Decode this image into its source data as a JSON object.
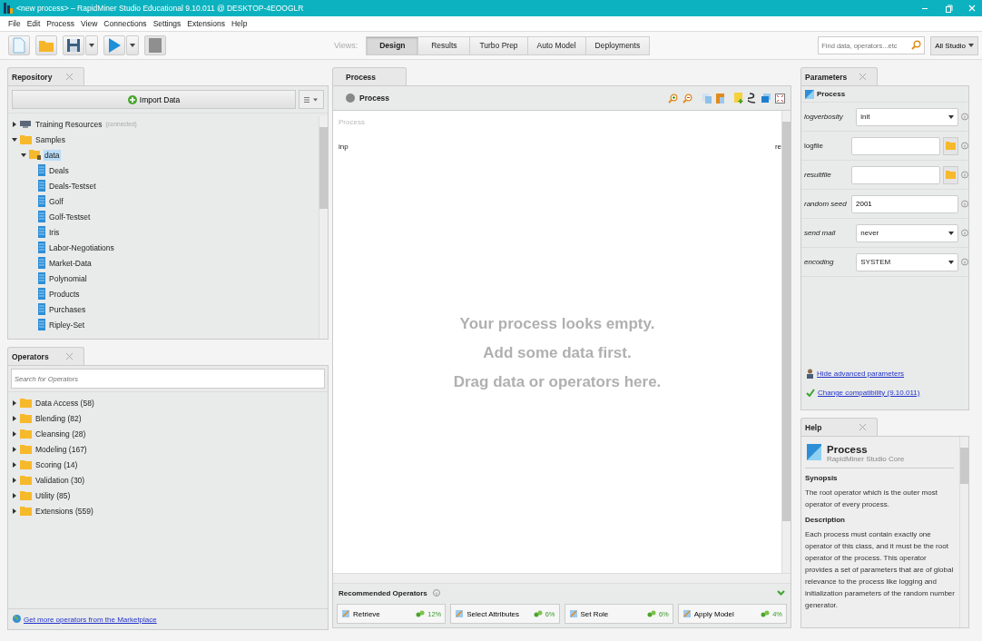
{
  "window": {
    "title": "<new process> – RapidMiner Studio Educational 9.10.011 @ DESKTOP-4EOOGLR"
  },
  "menu": [
    "File",
    "Edit",
    "Process",
    "View",
    "Connections",
    "Settings",
    "Extensions",
    "Help"
  ],
  "toolbar": {
    "views_label": "Views:",
    "views": [
      {
        "label": "Design",
        "selected": true
      },
      {
        "label": "Results",
        "selected": false
      },
      {
        "label": "Turbo Prep",
        "selected": false
      },
      {
        "label": "Auto Model",
        "selected": false
      },
      {
        "label": "Deployments",
        "selected": false
      }
    ],
    "search": {
      "placeholder": "Find data, operators...etc"
    },
    "scope": "All Studio"
  },
  "repository": {
    "tab": "Repository",
    "import_button": "Import Data",
    "tree": [
      {
        "label": "Training Resources",
        "note": "(connected)",
        "kind": "server",
        "expanded": false,
        "selected": false
      },
      {
        "label": "Samples",
        "kind": "folder",
        "expanded": true,
        "selected": false,
        "children": [
          {
            "label": "data",
            "kind": "locked-folder",
            "expanded": true,
            "selected": true,
            "children": [
              {
                "label": "Deals",
                "kind": "data",
                "selected": false
              },
              {
                "label": "Deals-Testset",
                "kind": "data",
                "selected": false
              },
              {
                "label": "Golf",
                "kind": "data",
                "selected": false
              },
              {
                "label": "Golf-Testset",
                "kind": "data",
                "selected": false
              },
              {
                "label": "Iris",
                "kind": "data",
                "selected": false
              },
              {
                "label": "Labor-Negotiations",
                "kind": "data",
                "selected": false
              },
              {
                "label": "Market-Data",
                "kind": "data",
                "selected": false
              },
              {
                "label": "Polynomial",
                "kind": "data",
                "selected": false
              },
              {
                "label": "Products",
                "kind": "data",
                "selected": false
              },
              {
                "label": "Purchases",
                "kind": "data",
                "selected": false
              },
              {
                "label": "Ripley-Set",
                "kind": "data",
                "selected": false
              }
            ]
          }
        ]
      }
    ]
  },
  "operators": {
    "tab": "Operators",
    "search": {
      "placeholder": "Search for Operators"
    },
    "groups": [
      {
        "label": "Data Access (58)",
        "expanded": false
      },
      {
        "label": "Blending (82)",
        "expanded": false
      },
      {
        "label": "Cleansing (28)",
        "expanded": false
      },
      {
        "label": "Modeling (167)",
        "expanded": false
      },
      {
        "label": "Scoring (14)",
        "expanded": false
      },
      {
        "label": "Validation (30)",
        "expanded": false
      },
      {
        "label": "Utility (85)",
        "expanded": false
      },
      {
        "label": "Extensions (559)",
        "expanded": false
      }
    ],
    "marketplace_link": "Get more operators from the Marketplace"
  },
  "process": {
    "tab": "Process",
    "breadcrumb": "Process",
    "canvas_title": "Process",
    "input_port": "inp",
    "output_port": "re",
    "empty_message": [
      "Your process looks empty.",
      "Add some data first.",
      "Drag data or operators here."
    ],
    "recommended": {
      "title": "Recommended Operators",
      "items": [
        {
          "label": "Retrieve",
          "share": "12%"
        },
        {
          "label": "Select Attributes",
          "share": "6%"
        },
        {
          "label": "Set Role",
          "share": "6%"
        },
        {
          "label": "Apply Model",
          "share": "4%"
        }
      ]
    }
  },
  "parameters": {
    "tab": "Parameters",
    "operator": "Process",
    "params": [
      {
        "name": "logverbosity",
        "kind": "select",
        "value": "init",
        "advanced": true
      },
      {
        "name": "logfile",
        "kind": "file",
        "advanced": false
      },
      {
        "name": "resultfile",
        "kind": "file",
        "advanced": true
      },
      {
        "name": "random seed",
        "kind": "text",
        "value": "2001",
        "advanced": true
      },
      {
        "name": "send mail",
        "kind": "select",
        "value": "never",
        "advanced": true
      },
      {
        "name": "encoding",
        "kind": "select",
        "value": "SYSTEM",
        "advanced": true
      }
    ],
    "hide_link": "Hide advanced parameters",
    "compat_link": "Change compatibility (9.10.011)"
  },
  "help": {
    "tab": "Help",
    "title": "Process",
    "subtitle": "RapidMiner Studio Core",
    "sections": [
      {
        "heading": "Synopsis",
        "text": "The root operator which is the outer most operator of every process."
      },
      {
        "heading": "Description",
        "text": "Each process must contain exactly one operator of this class, and it must be the root operator of the process. This operator provides a set of parameters that are of global relevance to the process like logging and initialization parameters of the random number generator."
      }
    ]
  }
}
